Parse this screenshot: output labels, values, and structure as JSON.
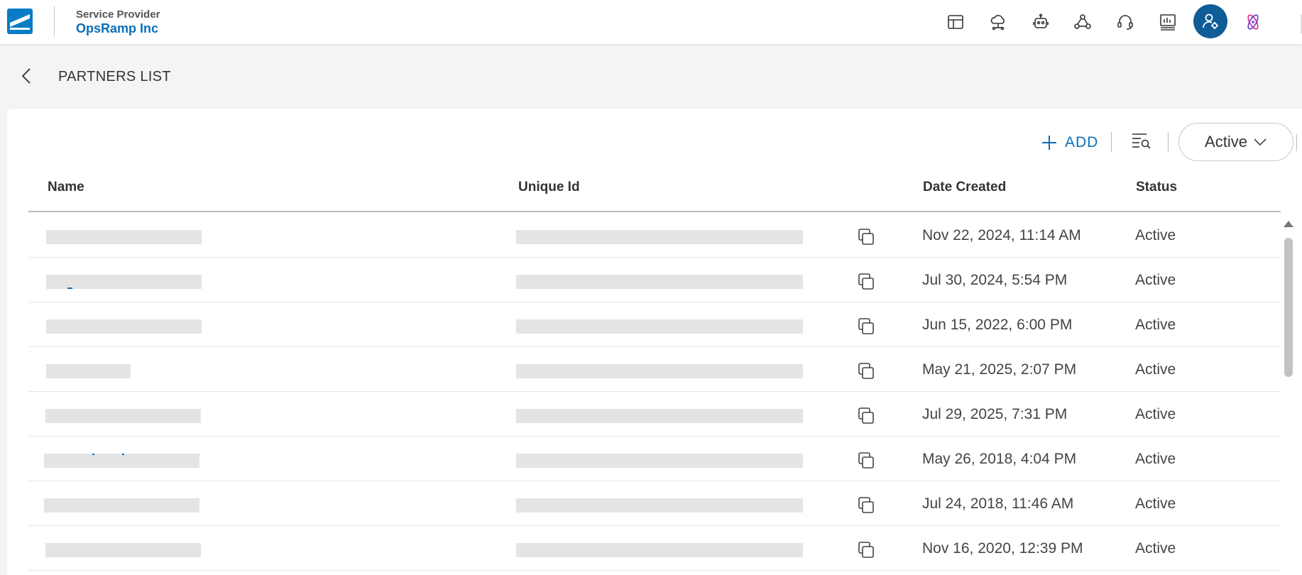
{
  "header": {
    "org_label": "Service Provider",
    "org_name": "OpsRamp Inc",
    "icons": [
      {
        "name": "dashboard-icon"
      },
      {
        "name": "cloud-network-icon"
      },
      {
        "name": "robot-icon"
      },
      {
        "name": "topology-icon"
      },
      {
        "name": "headset-icon"
      },
      {
        "name": "reports-icon"
      },
      {
        "name": "user-settings-icon",
        "active": true
      },
      {
        "name": "atom-icon"
      }
    ],
    "brand_color": "#0a6fb8",
    "active_icon_color": "#0f5d97"
  },
  "page": {
    "title": "PARTNERS LIST"
  },
  "toolbar": {
    "add_label": "ADD",
    "status_filter": "Active"
  },
  "table": {
    "columns": [
      "Name",
      "Unique Id",
      "Date Created",
      "Status"
    ],
    "rows": [
      {
        "date_created": "Nov 22, 2024, 11:14 AM",
        "status": "Active"
      },
      {
        "date_created": "Jul 30, 2024, 5:54 PM",
        "status": "Active"
      },
      {
        "date_created": "Jun 15, 2022, 6:00 PM",
        "status": "Active"
      },
      {
        "date_created": "May 21, 2025, 2:07 PM",
        "status": "Active"
      },
      {
        "date_created": "Jul 29, 2025, 7:31 PM",
        "status": "Active"
      },
      {
        "date_created": "May 26, 2018, 4:04 PM",
        "status": "Active"
      },
      {
        "date_created": "Jul 24, 2018, 11:46 AM",
        "status": "Active"
      },
      {
        "date_created": "Nov 16, 2020, 12:39 PM",
        "status": "Active"
      }
    ]
  }
}
